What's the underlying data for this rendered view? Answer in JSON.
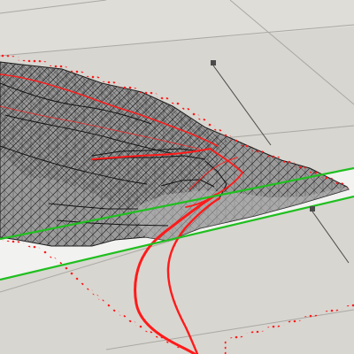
{
  "viewport": {
    "label": "",
    "colors": {
      "background": "#d7d5cf",
      "plane_light": "#e3e1dc",
      "plane_band": "#f4f4f2",
      "grid_line": "#a8a6a0",
      "mesh_line": "#1e1e1e",
      "mesh_fill": "#8e8e8e",
      "boundary_red": "#ff1a1a",
      "section_green": "#1fbf1f",
      "marker": "#4b4b4b"
    },
    "icons": {
      "vertex_marker": "square-marker-icon",
      "helper_line": "guide-line-icon"
    }
  }
}
